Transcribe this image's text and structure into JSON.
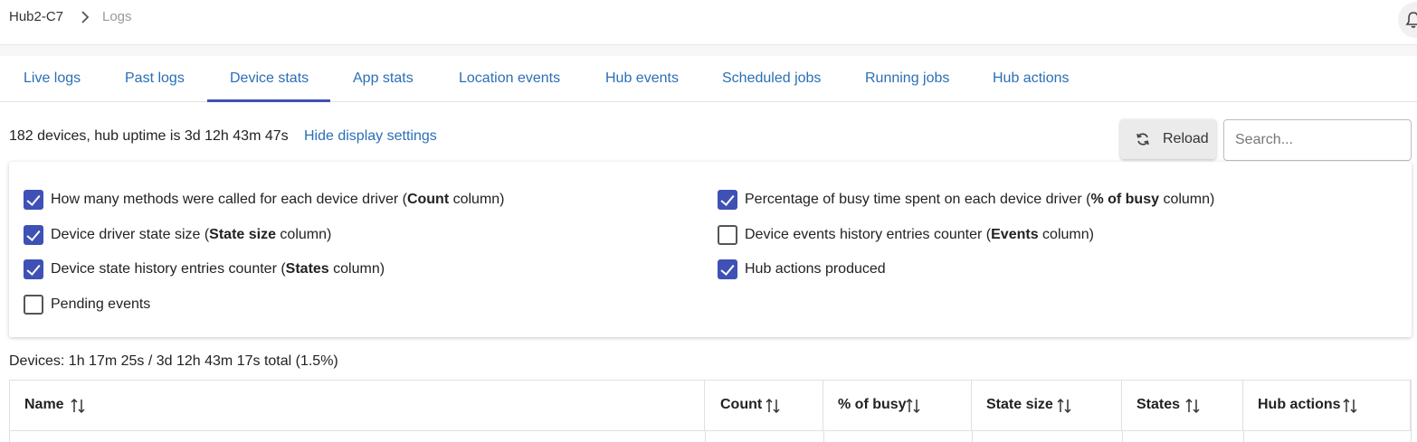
{
  "breadcrumb": {
    "hub": "Hub2-C7",
    "page": "Logs"
  },
  "tabs": [
    {
      "label": "Live logs",
      "active": false
    },
    {
      "label": "Past logs",
      "active": false
    },
    {
      "label": "Device stats",
      "active": true
    },
    {
      "label": "App stats",
      "active": false
    },
    {
      "label": "Location events",
      "active": false
    },
    {
      "label": "Hub events",
      "active": false
    },
    {
      "label": "Scheduled jobs",
      "active": false
    },
    {
      "label": "Running jobs",
      "active": false
    },
    {
      "label": "Hub actions",
      "active": false
    }
  ],
  "info": {
    "summary": "182 devices, hub uptime is 3d 12h 43m 47s",
    "toggle_link": "Hide display settings"
  },
  "toolbar": {
    "reload_label": "Reload",
    "search_placeholder": "Search..."
  },
  "settings": [
    {
      "pre": "How many methods were called for each device driver (",
      "bold": "Count",
      "post": " column)",
      "checked": true
    },
    {
      "pre": "Device driver state size (",
      "bold": "State size",
      "post": " column)",
      "checked": true
    },
    {
      "pre": "Device state history entries counter (",
      "bold": "States",
      "post": " column)",
      "checked": true
    },
    {
      "pre": "Pending events",
      "bold": "",
      "post": "",
      "checked": false
    },
    {
      "pre": "Percentage of busy time spent on each device driver (",
      "bold": "% of busy",
      "post": " column)",
      "checked": true
    },
    {
      "pre": "Device events history entries counter (",
      "bold": "Events",
      "post": " column)",
      "checked": false
    },
    {
      "pre": "Hub actions produced",
      "bold": "",
      "post": "",
      "checked": true
    }
  ],
  "devices_summary": "Devices: 1h 17m 25s / 3d 12h 43m 17s total (1.5%)",
  "table": {
    "columns": [
      "Name",
      "Count",
      "% of busy",
      "State size",
      "States",
      "Hub actions"
    ]
  },
  "colors": {
    "accent": "#3f51b5",
    "link": "#2a6fb6"
  },
  "icons": [
    "chevron-right-icon",
    "bell-icon",
    "refresh-icon",
    "sort-icon"
  ]
}
